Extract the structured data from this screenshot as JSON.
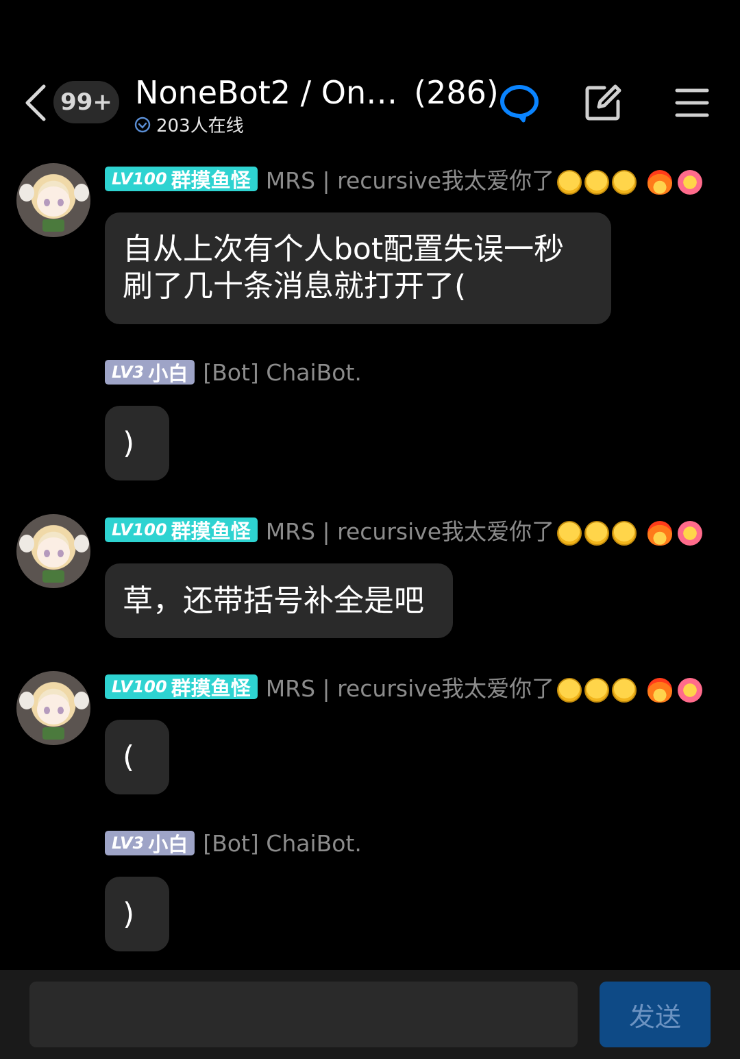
{
  "header": {
    "unread_badge": "99+",
    "group_name": "NoneBot2 / On…",
    "member_count": "(286)",
    "online_text": "203人在线",
    "accent_color": "#0a84ff"
  },
  "messages": [
    {
      "level_badge": "LV100",
      "level_title": "群摸鱼怪",
      "sender": "MRS | recursive我太爱你了",
      "text": "自从上次有个人bot配置失误一秒\n刷了几十条消息就打开了("
    },
    {
      "level_badge": "LV3",
      "level_title": "小白",
      "sender": "[Bot] ChaiBot.",
      "text": ")"
    },
    {
      "level_badge": "LV100",
      "level_title": "群摸鱼怪",
      "sender": "MRS | recursive我太爱你了",
      "text": "草，还带括号补全是吧"
    },
    {
      "level_badge": "LV100",
      "level_title": "群摸鱼怪",
      "sender": "MRS | recursive我太爱你了",
      "text": "("
    },
    {
      "level_badge": "LV3",
      "level_title": "小白",
      "sender": "[Bot] ChaiBot.",
      "text": ")"
    }
  ],
  "input": {
    "send_label": "发送",
    "value": ""
  }
}
